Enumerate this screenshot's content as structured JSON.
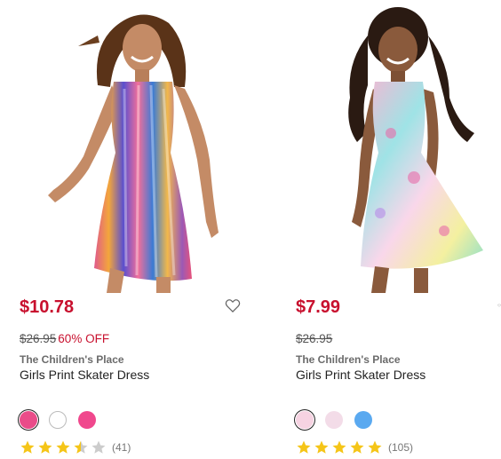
{
  "products": [
    {
      "price": "$10.78",
      "original_price": "$26.95",
      "discount": "60% OFF",
      "brand": "The Children's Place",
      "title": "Girls Print Skater Dress",
      "swatches": [
        "#ea4c89",
        "#ffffff",
        "#f0488d"
      ],
      "rating": 3.5,
      "review_count": "(41)"
    },
    {
      "price": "$7.99",
      "original_price": "$26.95",
      "brand": "The Children's Place",
      "title": "Girls Print Skater Dress",
      "swatches": [
        "#f6d3e2",
        "#f3dce8",
        "#5aa9f0"
      ],
      "rating": 5,
      "review_count": "(105)"
    }
  ],
  "colors": {
    "price": "#c8102e",
    "star": "#f5c518",
    "star_empty": "#cccccc"
  },
  "icons": [
    "heart-icon",
    "star-icon"
  ]
}
